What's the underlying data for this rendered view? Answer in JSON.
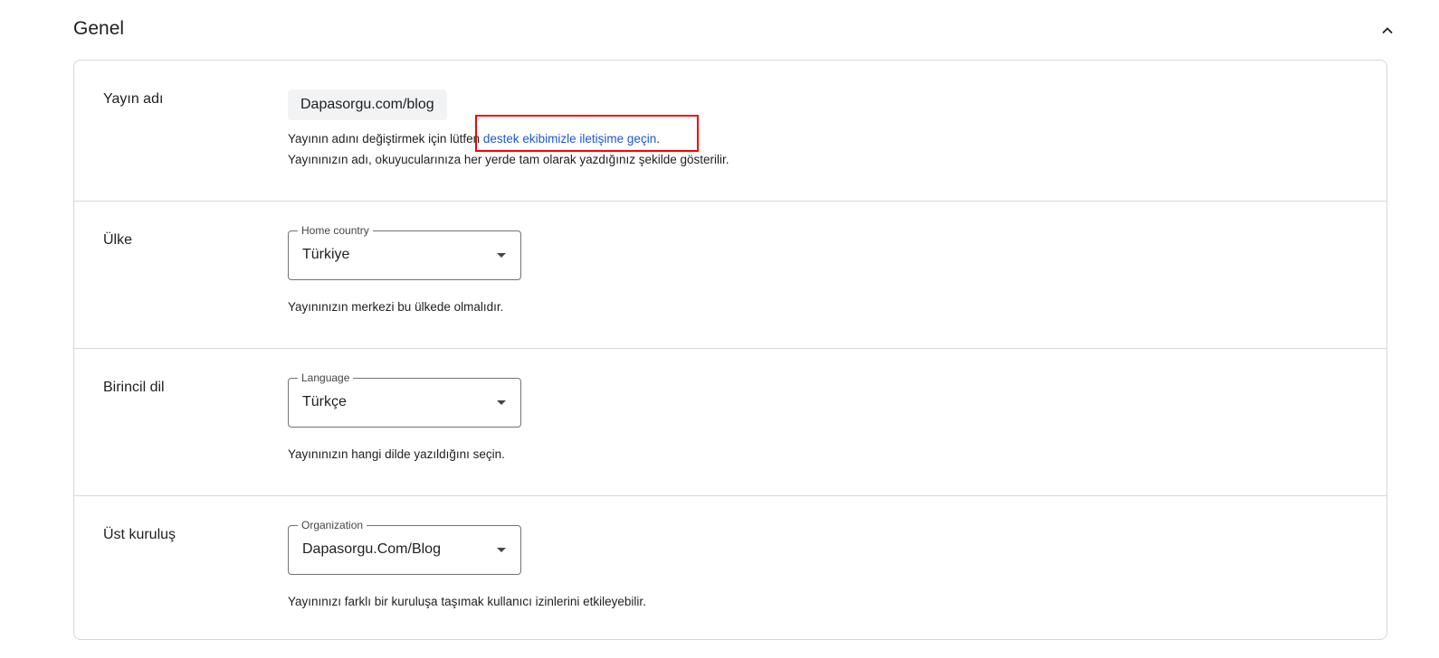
{
  "section": {
    "title": "Genel",
    "collapse_icon": "chevron-up-icon"
  },
  "rows": {
    "publication_name": {
      "label": "Yayın adı",
      "value": "Dapasorgu.com/blog",
      "help_prefix": "Yayının adını değiştirmek için lütfen ",
      "help_link": "destek ekibimizle iletişime geçin",
      "help_suffix": ".",
      "help_line2": "Yayınınızın adı, okuyucularınıza her yerde tam olarak yazdığınız şekilde gösterilir."
    },
    "country": {
      "label": "Ülke",
      "field_label": "Home country",
      "value": "Türkiye",
      "help": "Yayınınızın merkezi bu ülkede olmalıdır."
    },
    "language": {
      "label": "Birincil dil",
      "field_label": "Language",
      "value": "Türkçe",
      "help": "Yayınınızın hangi dilde yazıldığını seçin."
    },
    "organization": {
      "label": "Üst kuruluş",
      "field_label": "Organization",
      "value": "Dapasorgu.Com/Blog",
      "help": "Yayınınızı farklı bir kuruluşa taşımak kullanıcı izinlerini etkileyebilir."
    }
  },
  "colors": {
    "link": "#1a57d6",
    "highlight": "#ff0000",
    "border": "#d5d7da"
  }
}
